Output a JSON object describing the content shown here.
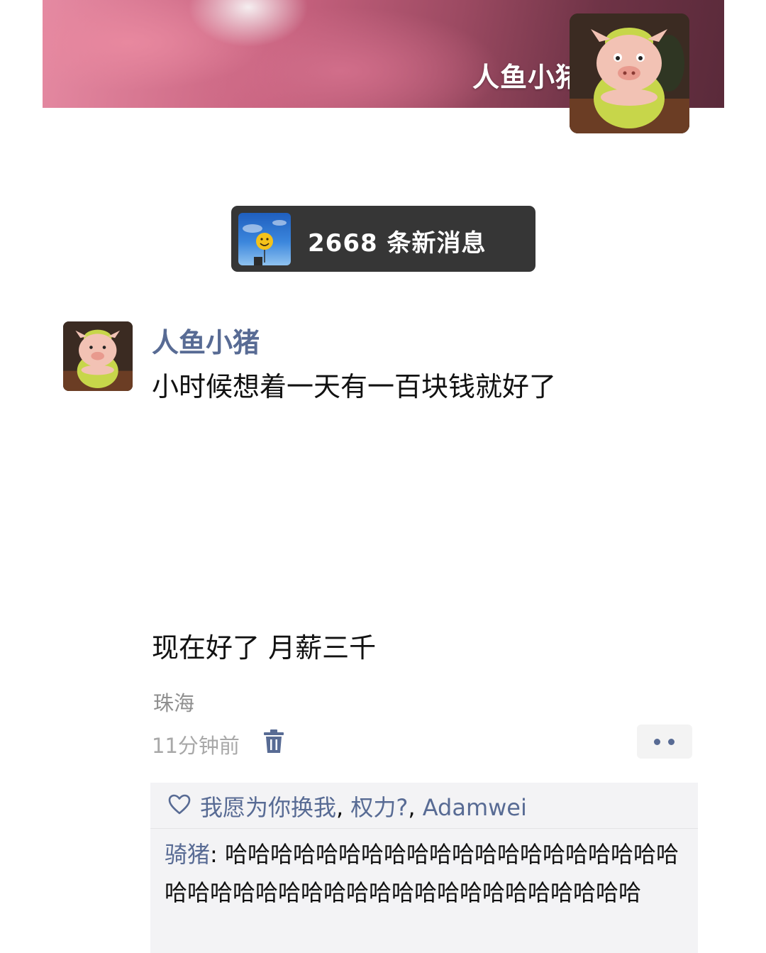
{
  "cover": {
    "name": "人鱼小猪",
    "avatar_icon": "pig-plush-avatar"
  },
  "notification": {
    "text": "2668 条新消息",
    "avatar_icon": "smiley-balloon-avatar"
  },
  "post": {
    "author": "人鱼小猪",
    "avatar_icon": "pig-plush-avatar",
    "line1": "小时候想着一天有一百块钱就好了",
    "line2": "现在好了 月薪三千",
    "location": "珠海",
    "time": "11分钟前",
    "delete_icon": "trash-icon",
    "more_icon": "more-dots-icon"
  },
  "likes": {
    "icon": "heart-icon",
    "users": [
      "我愿为你换我",
      "权力?",
      "Adamwei"
    ],
    "separator": ", "
  },
  "comment": {
    "author": "骑猪",
    "separator": ": ",
    "text": "哈哈哈哈哈哈哈哈哈哈哈哈哈哈哈哈哈哈哈哈哈哈哈哈哈哈哈哈哈哈哈哈哈哈哈哈哈哈哈哈哈"
  },
  "colors": {
    "link": "#586b94",
    "text": "#111111",
    "muted": "#a8a8a8",
    "comment_bg": "#f3f3f5",
    "toast_bg": "#363636"
  }
}
